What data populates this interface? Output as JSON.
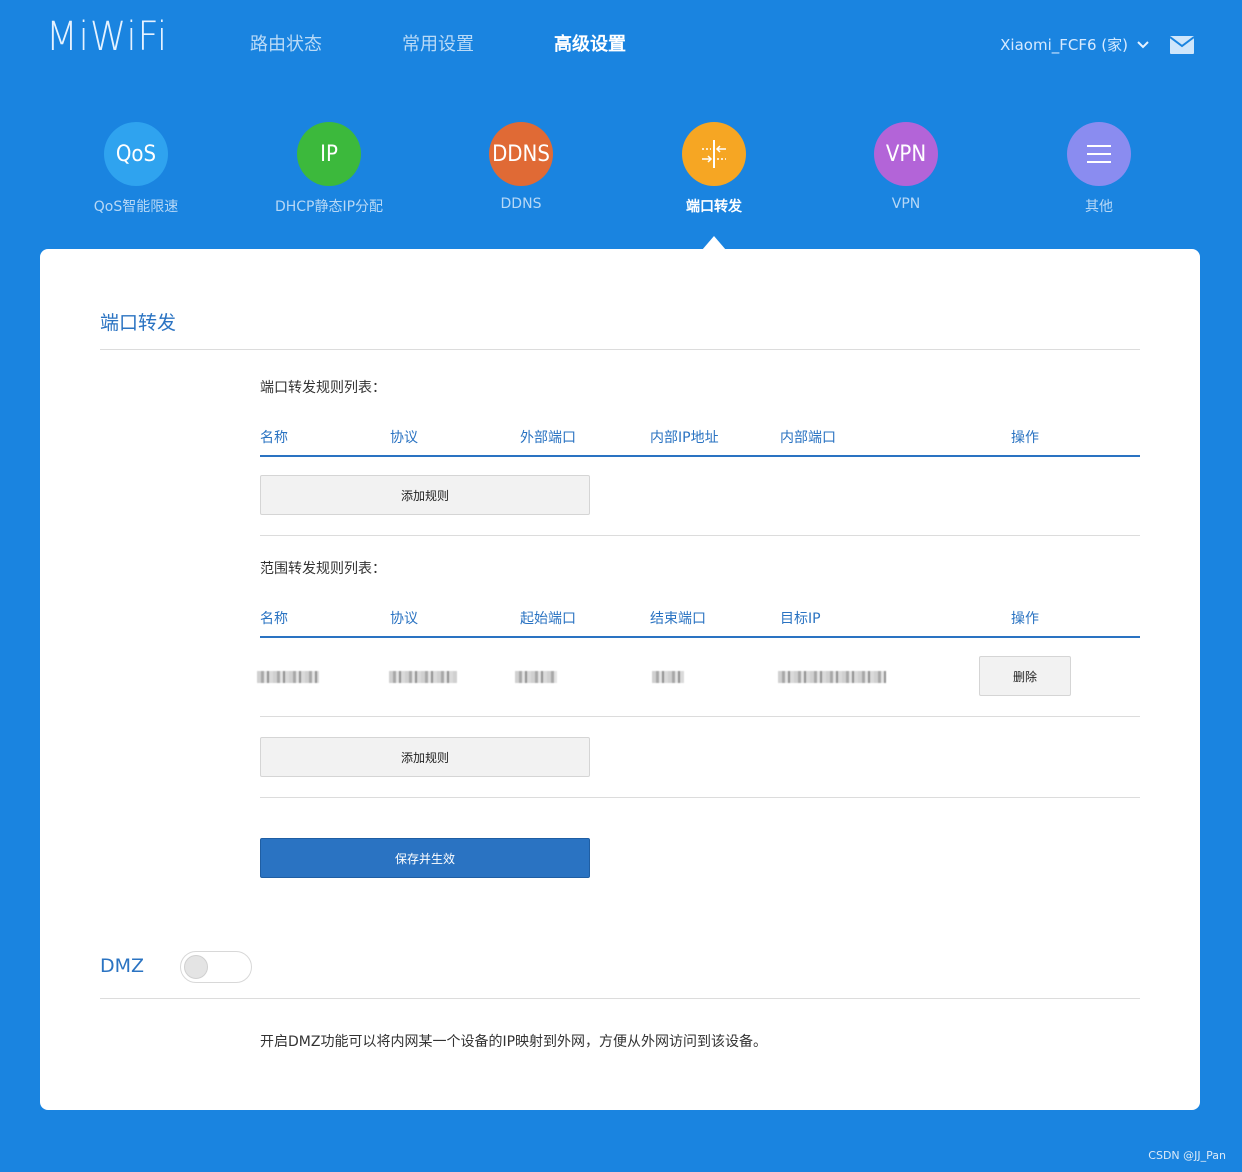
{
  "header": {
    "logo": "MiWiFi",
    "nav": [
      "路由状态",
      "常用设置",
      "高级设置"
    ],
    "active_nav": "高级设置",
    "device_name": "Xiaomi_FCF6 (家)"
  },
  "tools": [
    {
      "icon_text": "QoS",
      "label": "QoS智能限速",
      "color": "#2fa3ef"
    },
    {
      "icon_text": "IP",
      "label": "DHCP静态IP分配",
      "color": "#3cb93c"
    },
    {
      "icon_text": "DDNS",
      "label": "DDNS",
      "color": "#e06a35"
    },
    {
      "icon_text": "",
      "label": "端口转发",
      "color": "#f6a623",
      "icon": "port-forward-icon",
      "active": true
    },
    {
      "icon_text": "VPN",
      "label": "VPN",
      "color": "#b364d8"
    },
    {
      "icon_text": "",
      "label": "其他",
      "color": "#8a8cf0",
      "icon": "menu-icon"
    }
  ],
  "port_forward": {
    "title": "端口转发",
    "port_list_title": "端口转发规则列表：",
    "port_list_headers": [
      "名称",
      "协议",
      "外部端口",
      "内部IP地址",
      "内部端口",
      "操作"
    ],
    "add_rule_label": "添加规则",
    "range_list_title": "范围转发规则列表：",
    "range_list_headers": [
      "名称",
      "协议",
      "起始端口",
      "结束端口",
      "目标IP",
      "操作"
    ],
    "delete_label": "删除",
    "save_label": "保存并生效"
  },
  "dmz": {
    "title": "DMZ",
    "enabled": false,
    "description": "开启DMZ功能可以将内网某一个设备的IP映射到外网，方便从外网访问到该设备。"
  },
  "watermark": "CSDN @JJ_Pan"
}
